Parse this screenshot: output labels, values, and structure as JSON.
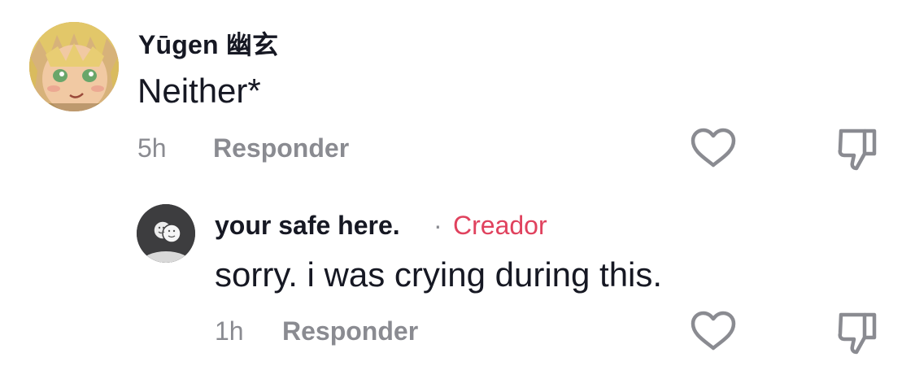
{
  "comments": [
    {
      "username": "Yūgen 幽玄",
      "text": "Neither*",
      "time": "5h",
      "reply_label": "Responder",
      "avatar_icon": "anime-character-avatar",
      "like_icon": "heart-outline-icon",
      "dislike_icon": "thumbs-down-outline-icon"
    }
  ],
  "reply": {
    "username": "your safe here.",
    "separator": "·",
    "badge": "Creador",
    "text": "sorry. i was crying during this.",
    "time": "1h",
    "reply_label": "Responder",
    "avatar_icon": "smiley-faces-avatar",
    "like_icon": "heart-outline-icon",
    "dislike_icon": "thumbs-down-outline-icon"
  },
  "colors": {
    "text_primary": "#161823",
    "text_secondary": "#8a8b91",
    "creator_badge": "#e0425e",
    "icon_stroke": "#8a8b91"
  }
}
